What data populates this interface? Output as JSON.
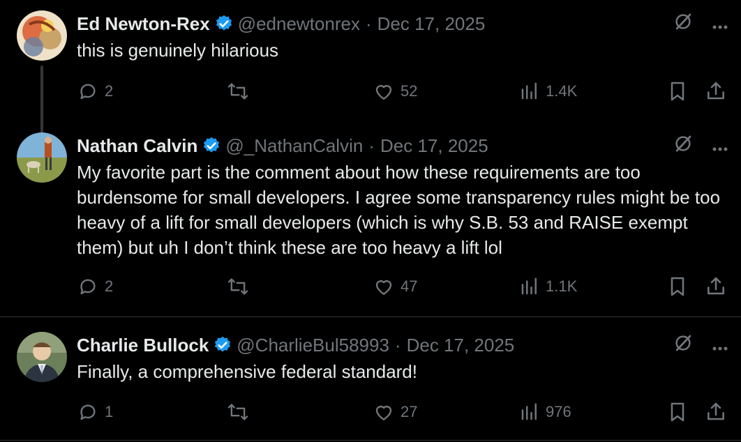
{
  "tweets": [
    {
      "name": "Ed Newton-Rex",
      "handle": "@ednewtonrex",
      "separator": "·",
      "date": "Dec 17, 2025",
      "text": "this is genuinely hilarious",
      "replies": "2",
      "likes": "52",
      "views": "1.4K",
      "avatar_colors": [
        "#c9a46a",
        "#d9572b",
        "#efe2c8",
        "#6a7fa0"
      ]
    },
    {
      "name": "Nathan Calvin",
      "handle": "@_NathanCalvin",
      "separator": "·",
      "date": "Dec 17, 2025",
      "text": "My favorite part is the comment about how these requirements are too burdensome for small developers. I agree some transparency rules might be too heavy of a lift for small developers (which is why S.B. 53 and RAISE exempt them) but uh I don’t think these are too heavy a lift lol",
      "replies": "2",
      "likes": "47",
      "views": "1.1K",
      "avatar_colors": [
        "#7fb3d8",
        "#8a9a4a",
        "#b8501e",
        "#d9d2b8"
      ]
    },
    {
      "name": "Charlie Bullock",
      "handle": "@CharlieBul58993",
      "separator": "·",
      "date": "Dec 17, 2025",
      "text": "Finally, a comprehensive federal standard!",
      "replies": "1",
      "likes": "27",
      "views": "976",
      "avatar_colors": [
        "#6b7f5a",
        "#2b3440",
        "#e8c9a8",
        "#a8b8c8"
      ]
    }
  ],
  "colors": {
    "background": "#000000",
    "text": "#e7e9ea",
    "muted": "#71767b",
    "verified": "#1d9bf0",
    "divider": "#2f3336"
  },
  "icons": [
    "verified-badge-icon",
    "grok-icon",
    "more-icon",
    "reply-icon",
    "retweet-icon",
    "like-icon",
    "views-icon",
    "bookmark-icon",
    "share-icon"
  ]
}
